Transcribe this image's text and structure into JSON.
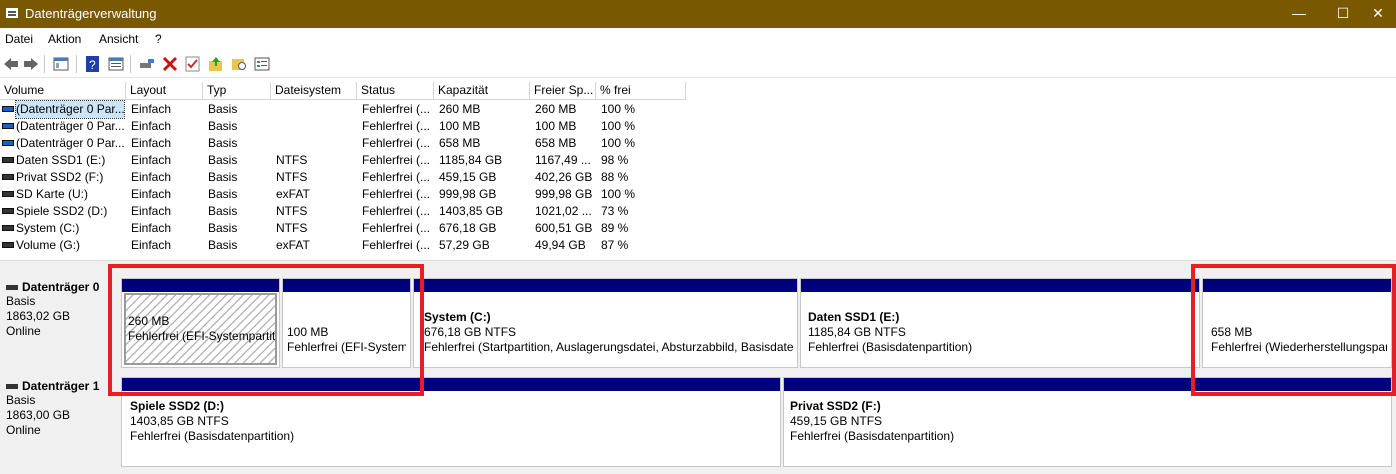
{
  "window": {
    "title": "Datenträgerverwaltung",
    "minimize": "—",
    "maximize": "☐",
    "close": "✕"
  },
  "menu": [
    "Datei",
    "Aktion",
    "Ansicht",
    "?"
  ],
  "toolbar_icons": [
    "back-icon",
    "forward-icon",
    "console-tree-icon",
    "help-icon",
    "properties-icon",
    "connect-icon",
    "delete-icon",
    "check-icon",
    "folder-up-icon",
    "search-folder-icon",
    "list-icon"
  ],
  "columns": [
    "Volume",
    "Layout",
    "Typ",
    "Dateisystem",
    "Status",
    "Kapazität",
    "Freier Sp...",
    "% frei"
  ],
  "volumes": [
    {
      "volume": "(Datenträger 0 Par...",
      "layout": "Einfach",
      "typ": "Basis",
      "fs": "",
      "status": "Fehlerfrei (...",
      "kap": "260 MB",
      "frei": "260 MB",
      "pct": "100 %"
    },
    {
      "volume": "(Datenträger 0 Par...",
      "layout": "Einfach",
      "typ": "Basis",
      "fs": "",
      "status": "Fehlerfrei (...",
      "kap": "100 MB",
      "frei": "100 MB",
      "pct": "100 %"
    },
    {
      "volume": "(Datenträger 0 Par...",
      "layout": "Einfach",
      "typ": "Basis",
      "fs": "",
      "status": "Fehlerfrei (...",
      "kap": "658 MB",
      "frei": "658 MB",
      "pct": "100 %"
    },
    {
      "volume": "Daten SSD1 (E:)",
      "layout": "Einfach",
      "typ": "Basis",
      "fs": "NTFS",
      "status": "Fehlerfrei (...",
      "kap": "1185,84 GB",
      "frei": "1167,49 ...",
      "pct": "98 %"
    },
    {
      "volume": "Privat SSD2 (F:)",
      "layout": "Einfach",
      "typ": "Basis",
      "fs": "NTFS",
      "status": "Fehlerfrei (...",
      "kap": "459,15 GB",
      "frei": "402,26 GB",
      "pct": "88 %"
    },
    {
      "volume": "SD Karte (U:)",
      "layout": "Einfach",
      "typ": "Basis",
      "fs": "exFAT",
      "status": "Fehlerfrei (...",
      "kap": "999,98 GB",
      "frei": "999,98 GB",
      "pct": "100 %"
    },
    {
      "volume": "Spiele SSD2 (D:)",
      "layout": "Einfach",
      "typ": "Basis",
      "fs": "NTFS",
      "status": "Fehlerfrei (...",
      "kap": "1403,85 GB",
      "frei": "1021,02 ...",
      "pct": "73 %"
    },
    {
      "volume": "System (C:)",
      "layout": "Einfach",
      "typ": "Basis",
      "fs": "NTFS",
      "status": "Fehlerfrei (...",
      "kap": "676,18 GB",
      "frei": "600,51 GB",
      "pct": "89 %"
    },
    {
      "volume": "Volume (G:)",
      "layout": "Einfach",
      "typ": "Basis",
      "fs": "exFAT",
      "status": "Fehlerfrei (...",
      "kap": "57,29 GB",
      "frei": "49,94 GB",
      "pct": "87 %"
    }
  ],
  "disks": [
    {
      "name": "Datenträger 0",
      "type": "Basis",
      "size": "1863,02 GB",
      "state": "Online",
      "partitions": [
        {
          "name": "",
          "size": "260 MB",
          "status": "Fehlerfrei (EFI-Systempartition)"
        },
        {
          "name": "",
          "size": "100 MB",
          "status": "Fehlerfrei (EFI-Systempartition)"
        },
        {
          "name": "System  (C:)",
          "size": "676,18 GB NTFS",
          "status": "Fehlerfrei (Startpartition, Auslagerungsdatei, Absturzabbild, Basisdatenpartition)"
        },
        {
          "name": "Daten SSD1  (E:)",
          "size": "1185,84 GB NTFS",
          "status": "Fehlerfrei (Basisdatenpartition)"
        },
        {
          "name": "",
          "size": "658 MB",
          "status": "Fehlerfrei (Wiederherstellungspartition)"
        }
      ]
    },
    {
      "name": "Datenträger 1",
      "type": "Basis",
      "size": "1863,00 GB",
      "state": "Online",
      "partitions": [
        {
          "name": "Spiele SSD2  (D:)",
          "size": "1403,85 GB NTFS",
          "status": "Fehlerfrei (Basisdatenpartition)"
        },
        {
          "name": "Privat SSD2  (F:)",
          "size": "459,15 GB NTFS",
          "status": "Fehlerfrei (Basisdatenpartition)"
        }
      ]
    }
  ],
  "colors": {
    "titlebar": "#7a5800",
    "partition_bar": "#00007f",
    "highlight": "#e81e25"
  }
}
